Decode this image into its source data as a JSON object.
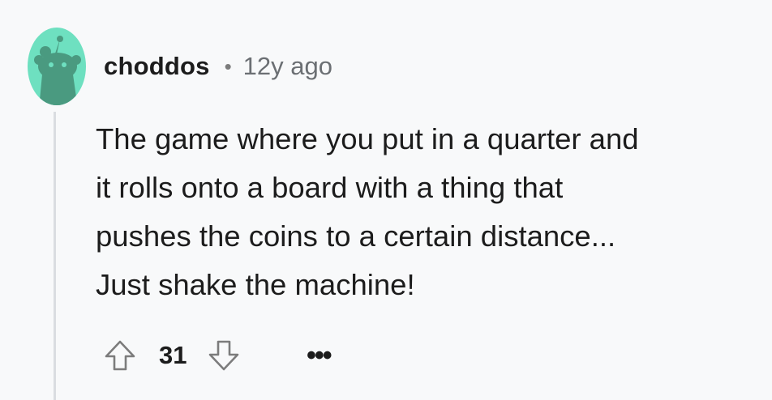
{
  "comment": {
    "author": "choddos",
    "separator": "•",
    "time": "12y ago",
    "body_lines": [
      "The game where you put in a quarter and",
      "it rolls onto a board with a thing that",
      "pushes the coins to a certain distance...",
      "Just shake the machine!"
    ],
    "score": "31",
    "more_label": "•••"
  },
  "icons": {
    "avatar": "snoo-avatar-icon",
    "upvote": "upvote-arrow-icon",
    "downvote": "downvote-arrow-icon",
    "more": "more-options-icon"
  },
  "colors": {
    "avatar_bg": "#6ee0c0",
    "avatar_figure": "#4a9a80",
    "text": "#1c1c1c",
    "muted": "#6b6f73",
    "thread_line": "#dadde1",
    "background": "#f8f9fa"
  }
}
